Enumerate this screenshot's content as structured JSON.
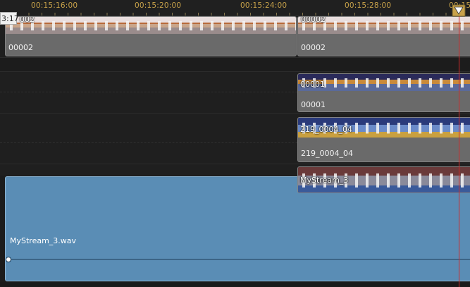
{
  "ruler": {
    "current_timecode_fragment": "3:17",
    "tick_labels": [
      "00:15:16:00",
      "00:15:20:00",
      "00:15:24:00",
      "00:15:28:00",
      "00:15:"
    ]
  },
  "tracks": {
    "video1": {
      "clip_a": {
        "label": "00002",
        "thumb_label": "002"
      },
      "clip_b": {
        "label": "00002",
        "thumb_label": "00002"
      }
    },
    "video2": {
      "clip": {
        "thumb_label": "00001",
        "label": "00001"
      }
    },
    "video3": {
      "clip": {
        "thumb_label": "219_0004_04",
        "label": "219_0004_04"
      }
    },
    "video4": {
      "clip": {
        "thumb_label": "MyStream_3"
      }
    },
    "audio1": {
      "clip": {
        "label": "MyStream_3.wav"
      }
    }
  },
  "colors": {
    "ruler_text": "#c8a24a",
    "playhead": "#d02a2a",
    "audio_clip": "#5a8db5",
    "video_clip": "#6a6a6a"
  }
}
